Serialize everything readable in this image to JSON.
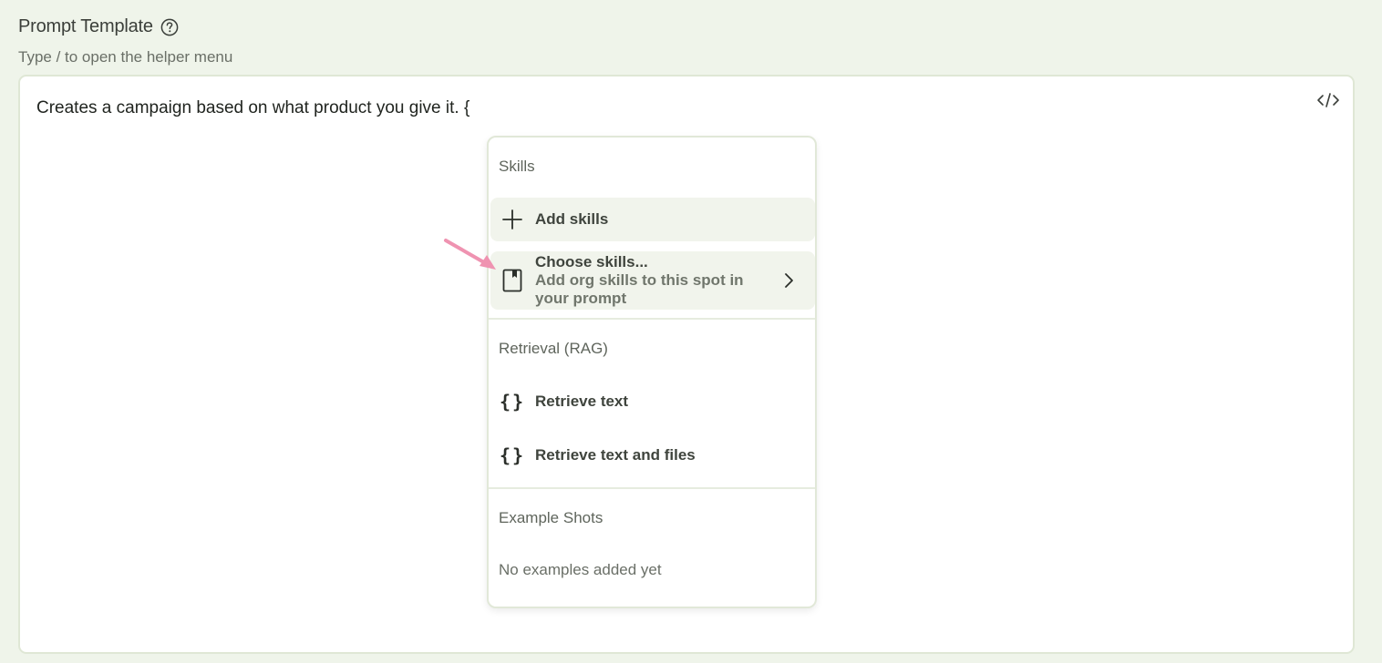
{
  "header": {
    "title": "Prompt Template",
    "subtitle": "Type / to open the helper menu"
  },
  "editor": {
    "text": "Creates a campaign based on what product you give it. {",
    "code_toggle_icon": "code-icon"
  },
  "menu": {
    "sections": {
      "skills": {
        "label": "Skills",
        "add": {
          "label": "Add skills",
          "icon": "plus-icon"
        },
        "choose": {
          "label": "Choose skills...",
          "description": "Add org skills to this spot in your prompt",
          "icon": "book-icon",
          "chevron": "chevron-right-icon"
        }
      },
      "rag": {
        "label": "Retrieval (RAG)",
        "retrieve_text": {
          "label": "Retrieve text",
          "icon": "braces-icon"
        },
        "retrieve_text_files": {
          "label": "Retrieve text and files",
          "icon": "braces-icon"
        }
      },
      "examples": {
        "label": "Example Shots",
        "empty": "No examples added yet"
      }
    }
  },
  "colors": {
    "page_bg": "#eff4ea",
    "highlight_bg": "#f1f4ec",
    "arrow": "#ef93b1"
  }
}
